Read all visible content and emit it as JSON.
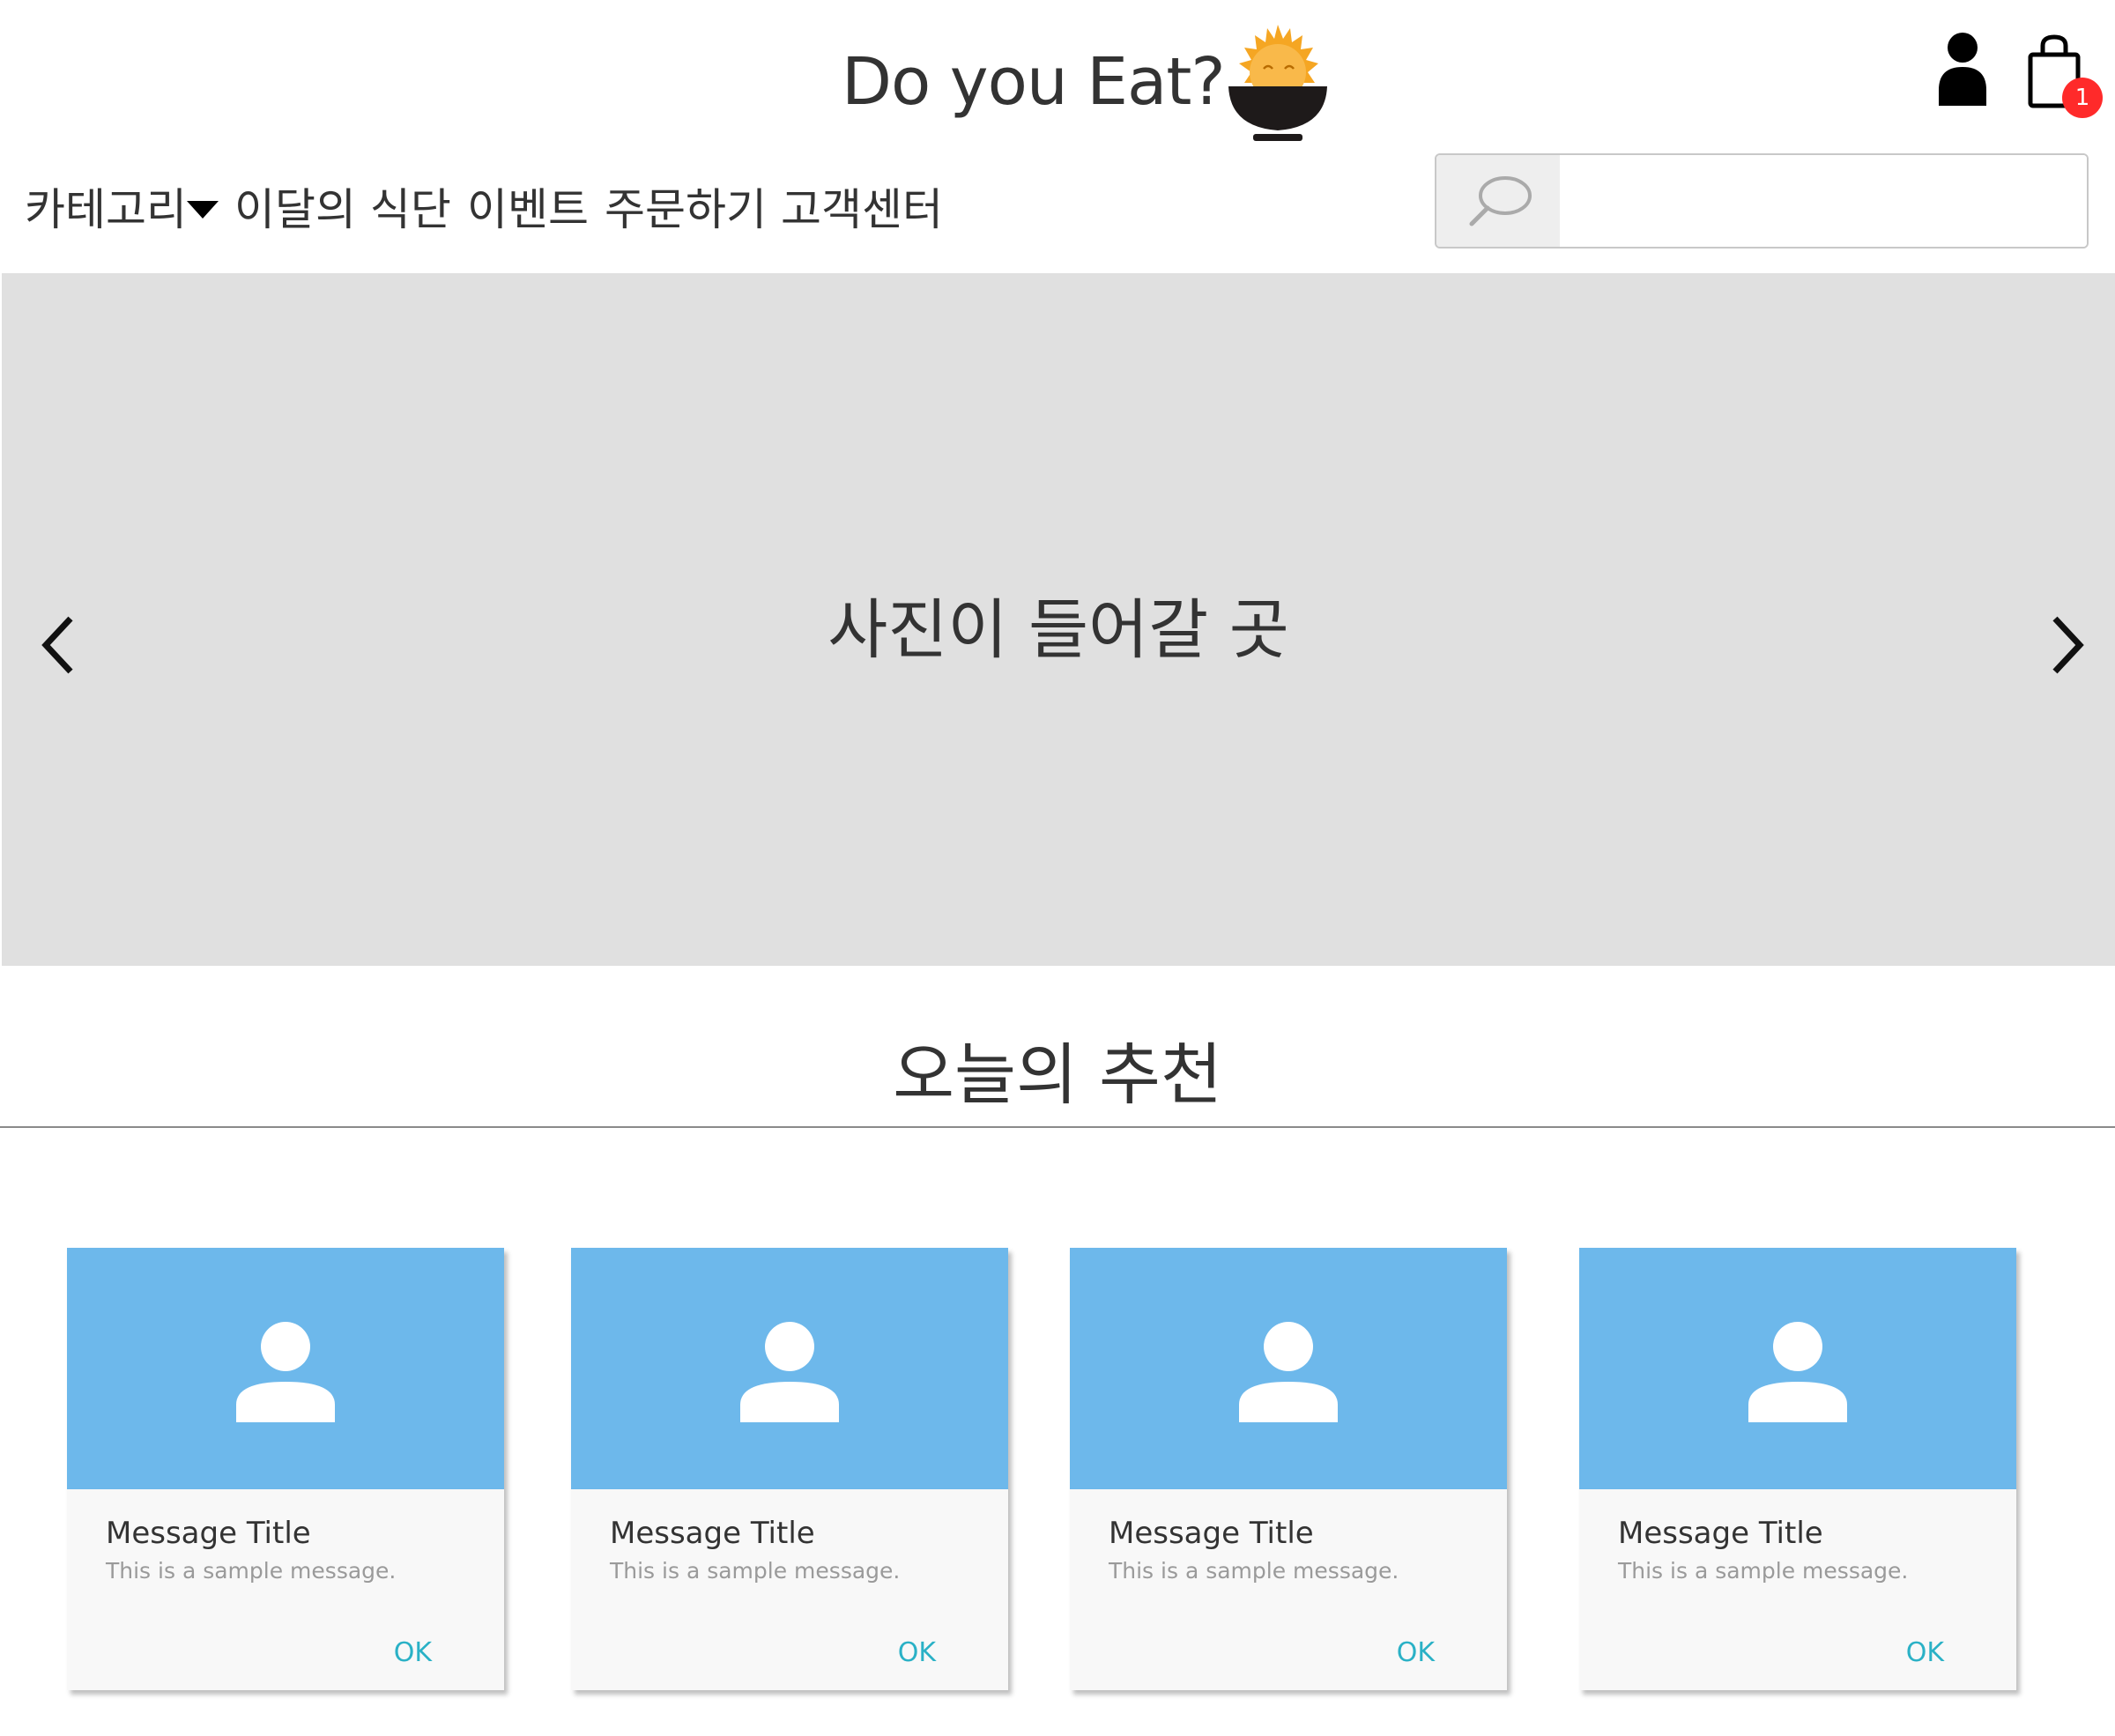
{
  "header": {
    "brand_title": "Do you Eat?",
    "logo_icon": "rice-bowl-sun-logo",
    "user_icon": "user-icon",
    "cart_icon": "shopping-bag-icon",
    "cart_count": "1"
  },
  "nav": {
    "items": [
      {
        "label": "카테고리"
      },
      {
        "label": "이달의 식단"
      },
      {
        "label": "이벤트"
      },
      {
        "label": "주문하기"
      },
      {
        "label": "고객센터"
      }
    ]
  },
  "search": {
    "placeholder": "",
    "value": ""
  },
  "banner": {
    "text": "사진이 들어갈 곳",
    "prev_icon": "chevron-left-icon",
    "next_icon": "chevron-right-icon"
  },
  "section": {
    "title": "오늘의 추천"
  },
  "cards": [
    {
      "title": "Message Title",
      "message": "This is a sample message.",
      "action": "OK"
    },
    {
      "title": "Message Title",
      "message": "This is a sample message.",
      "action": "OK"
    },
    {
      "title": "Message Title",
      "message": "This is a sample message.",
      "action": "OK"
    },
    {
      "title": "Message Title",
      "message": "This is a sample message.",
      "action": "OK"
    }
  ],
  "colors": {
    "banner_bg": "#e0e0e0",
    "card_media": "#6db8eb",
    "accent_ok": "#2ab1c6",
    "badge": "#ff2a2a"
  }
}
